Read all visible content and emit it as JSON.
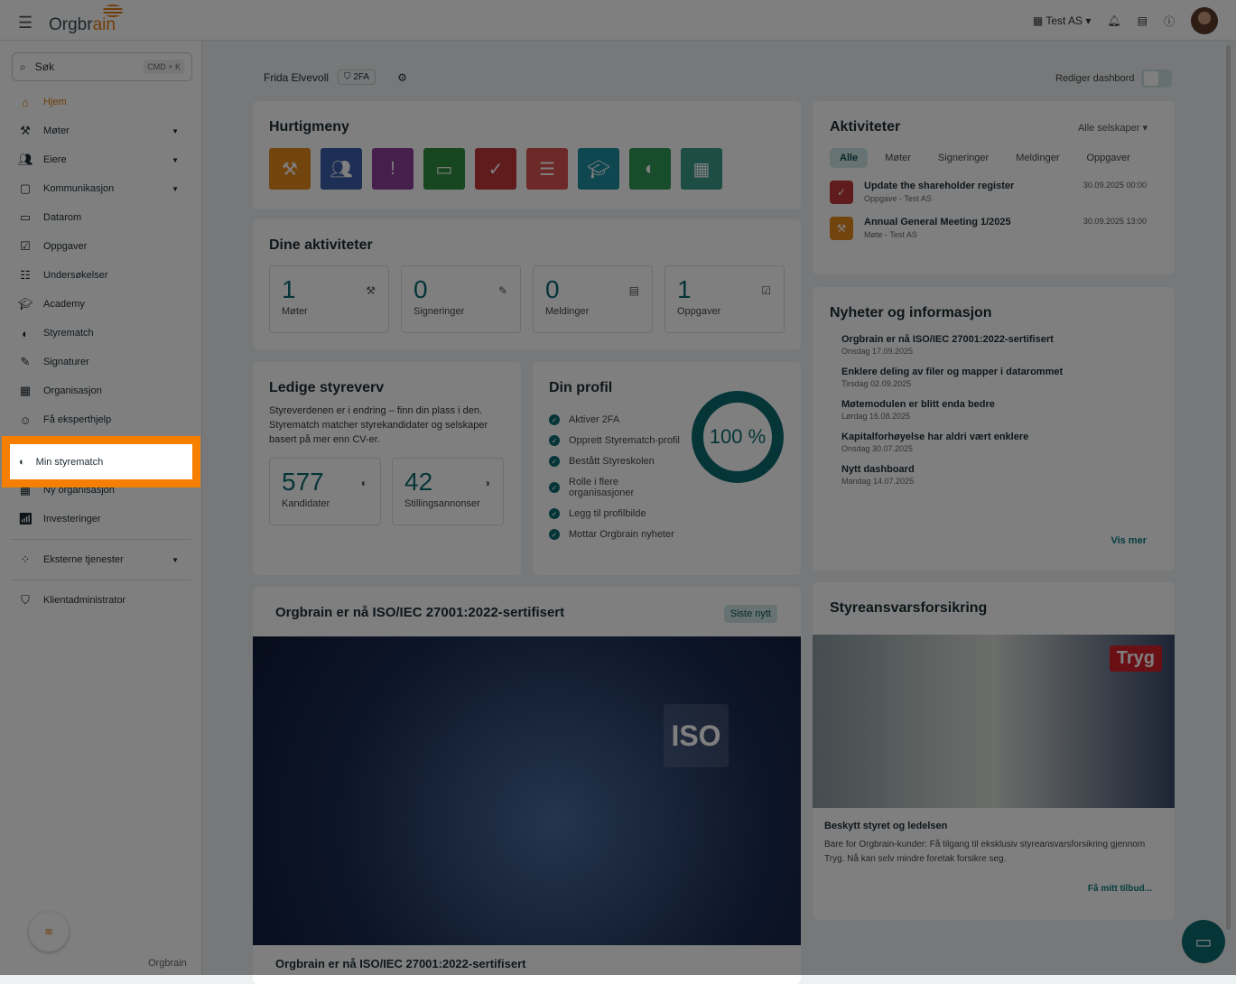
{
  "header": {
    "logo": "Orgbrain",
    "company": "Test AS"
  },
  "search": {
    "placeholder": "Søk",
    "shortcut": "CMD + K"
  },
  "sidebar": {
    "items": [
      {
        "label": "Hjem",
        "icon": "home-icon",
        "active": true
      },
      {
        "label": "Møter",
        "icon": "gavel-icon",
        "expand": true
      },
      {
        "label": "Eiere",
        "icon": "people-icon",
        "expand": true
      },
      {
        "label": "Kommunikasjon",
        "icon": "message-icon",
        "expand": true
      },
      {
        "label": "Datarom",
        "icon": "folder-icon"
      },
      {
        "label": "Oppgaver",
        "icon": "task-icon"
      },
      {
        "label": "Undersøkelser",
        "icon": "survey-icon"
      },
      {
        "label": "Academy",
        "icon": "school-icon"
      },
      {
        "label": "Styrematch",
        "icon": "match-icon"
      },
      {
        "label": "Signaturer",
        "icon": "signature-icon"
      },
      {
        "label": "Organisasjon",
        "icon": "building-icon"
      },
      {
        "label": "Få eksperthjelp",
        "icon": "expert-icon"
      },
      {
        "label": "Min styrematch",
        "icon": "match-icon"
      },
      {
        "label": "Ny organisasjon",
        "icon": "add-building-icon"
      },
      {
        "label": "Investeringer",
        "icon": "chart-icon"
      },
      {
        "label": "Eksterne tjenester",
        "icon": "services-icon",
        "expand": true
      },
      {
        "label": "Klientadministrator",
        "icon": "shield-icon"
      }
    ],
    "footer_logo": "Orgbrain"
  },
  "user": {
    "name": "Frida Elvevoll",
    "badge": "2FA"
  },
  "edit_dashboard": "Rediger dashbord",
  "quick": {
    "title": "Hurtigmeny"
  },
  "my_activities": {
    "title": "Dine aktiviteter",
    "stats": [
      {
        "value": "1",
        "label": "Møter"
      },
      {
        "value": "0",
        "label": "Signeringer"
      },
      {
        "value": "0",
        "label": "Meldinger"
      },
      {
        "value": "1",
        "label": "Oppgaver"
      }
    ]
  },
  "vacant": {
    "title": "Ledige styreverv",
    "text": "Styreverdenen er i endring – finn din plass i den. Styrematch matcher styrekandidater og selskaper basert på mer enn CV-er.",
    "stats": [
      {
        "value": "577",
        "label": "Kandidater"
      },
      {
        "value": "42",
        "label": "Stillingsannonser"
      }
    ]
  },
  "profile": {
    "title": "Din profil",
    "percent": "100 %",
    "progress": 100,
    "items": [
      "Aktiver 2FA",
      "Opprett Styrematch-profil",
      "Bestått Styreskolen",
      "Rolle i flere organisasjoner",
      "Legg til profilbilde",
      "Mottar Orgbrain nyheter"
    ]
  },
  "activities": {
    "title": "Aktiviteter",
    "filter": "Alle selskaper",
    "tabs": [
      "Alle",
      "Møter",
      "Signeringer",
      "Meldinger",
      "Oppgaver"
    ],
    "items": [
      {
        "title": "Update the shareholder register",
        "sub": "Oppgave - Test AS",
        "date": "30.09.2025 00:00",
        "color": "#c0393b"
      },
      {
        "title": "Annual General Meeting 1/2025",
        "sub": "Møte - Test AS",
        "date": "30.09.2025 13:00",
        "color": "#e48a1d"
      }
    ]
  },
  "news": {
    "title": "Nyheter og informasjon",
    "items": [
      {
        "title": "Orgbrain er nå ISO/IEC 27001:2022-sertifisert",
        "date": "Onsdag 17.09.2025"
      },
      {
        "title": "Enklere deling av filer og mapper i datarommet",
        "date": "Tirsdag 02.09.2025"
      },
      {
        "title": "Møtemodulen er blitt enda bedre",
        "date": "Lørdag 16.08.2025"
      },
      {
        "title": "Kapitalforhøyelse har aldri vært enklere",
        "date": "Onsdag 30.07.2025"
      },
      {
        "title": "Nytt dashboard",
        "date": "Mandag 14.07.2025"
      }
    ],
    "more": "Vis mer"
  },
  "iso": {
    "title": "Orgbrain er nå ISO/IEC 27001:2022-sertifisert",
    "badge": "Siste nytt",
    "image_text": "ISO",
    "caption": "Orgbrain er nå ISO/IEC 27001:2022-sertifisert"
  },
  "insurance": {
    "title": "Styreansvarsforsikring",
    "brand": "Tryg",
    "heading": "Beskytt styret og ledelsen",
    "text": "Bare for Orgbrain-kunder: Få tilgang til eksklusiv styreansvarsforsikring gjennom Tryg. Nå kan selv mindre foretak forsikre seg.",
    "link": "Få mitt tilbud..."
  }
}
